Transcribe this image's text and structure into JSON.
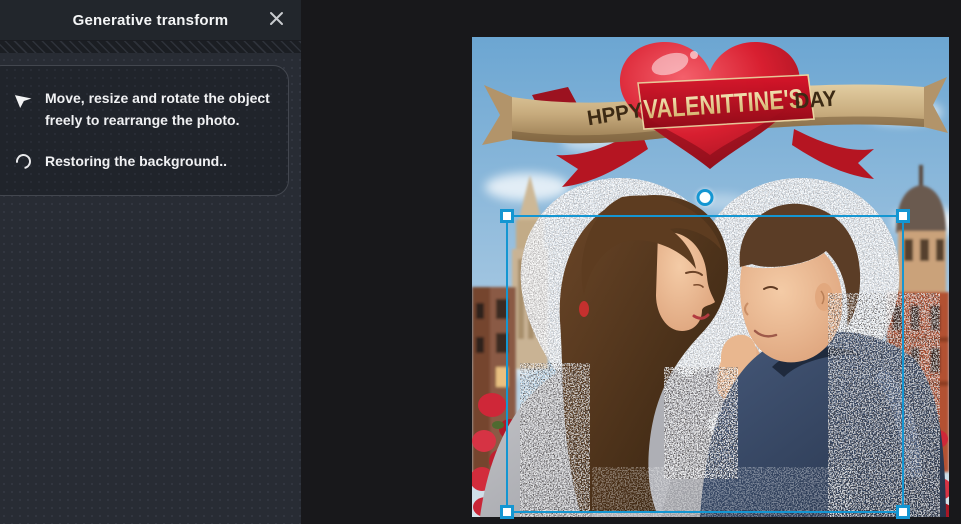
{
  "panel": {
    "title": "Generative transform",
    "move_instruction": "Move, resize and rotate the object freely to rearrange the photo.",
    "status_text": "Restoring the background..",
    "icons": {
      "close": "close-icon",
      "cursor": "cursor-arrow-icon",
      "spinner": "loading-spinner-icon"
    }
  },
  "canvas": {
    "photo": {
      "description": "AI-generated Valentine's Day photo of a couple touching foreheads in front of a glittering heart backdrop, city towers and red roses, with generative dissolve noise",
      "banner": {
        "left_word": "HPPY",
        "center_word": "VALENITTINE'S",
        "right_word": "DAY"
      }
    },
    "selection": {
      "handles": [
        "top-left",
        "top-right",
        "bottom-left",
        "bottom-right",
        "rotate"
      ]
    }
  },
  "colors": {
    "accent_selection": "#1496d2",
    "panel_bg": "#282c34",
    "card_bg": "#20242b",
    "canvas_bg": "#18181b",
    "heart_red": "#d81f30",
    "ribbon_gold": "#c7ab7d"
  }
}
